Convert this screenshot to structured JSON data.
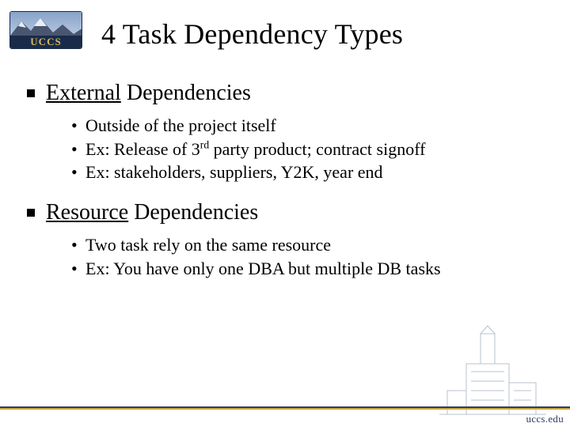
{
  "brand": {
    "logo_text": "UCCS",
    "footer_url": "uccs.edu"
  },
  "title": "4 Task Dependency Types",
  "sections": [
    {
      "heading_u": "External",
      "heading_rest": " Dependencies",
      "bullets": [
        "Outside of the project itself",
        "Ex: Release of 3rd party product; contract signoff",
        "Ex: stakeholders, suppliers, Y2K, year end"
      ]
    },
    {
      "heading_u": "Resource",
      "heading_rest": " Dependencies",
      "bullets": [
        "Two task rely on the same resource",
        "Ex: You have only one DBA but multiple DB tasks"
      ]
    }
  ]
}
